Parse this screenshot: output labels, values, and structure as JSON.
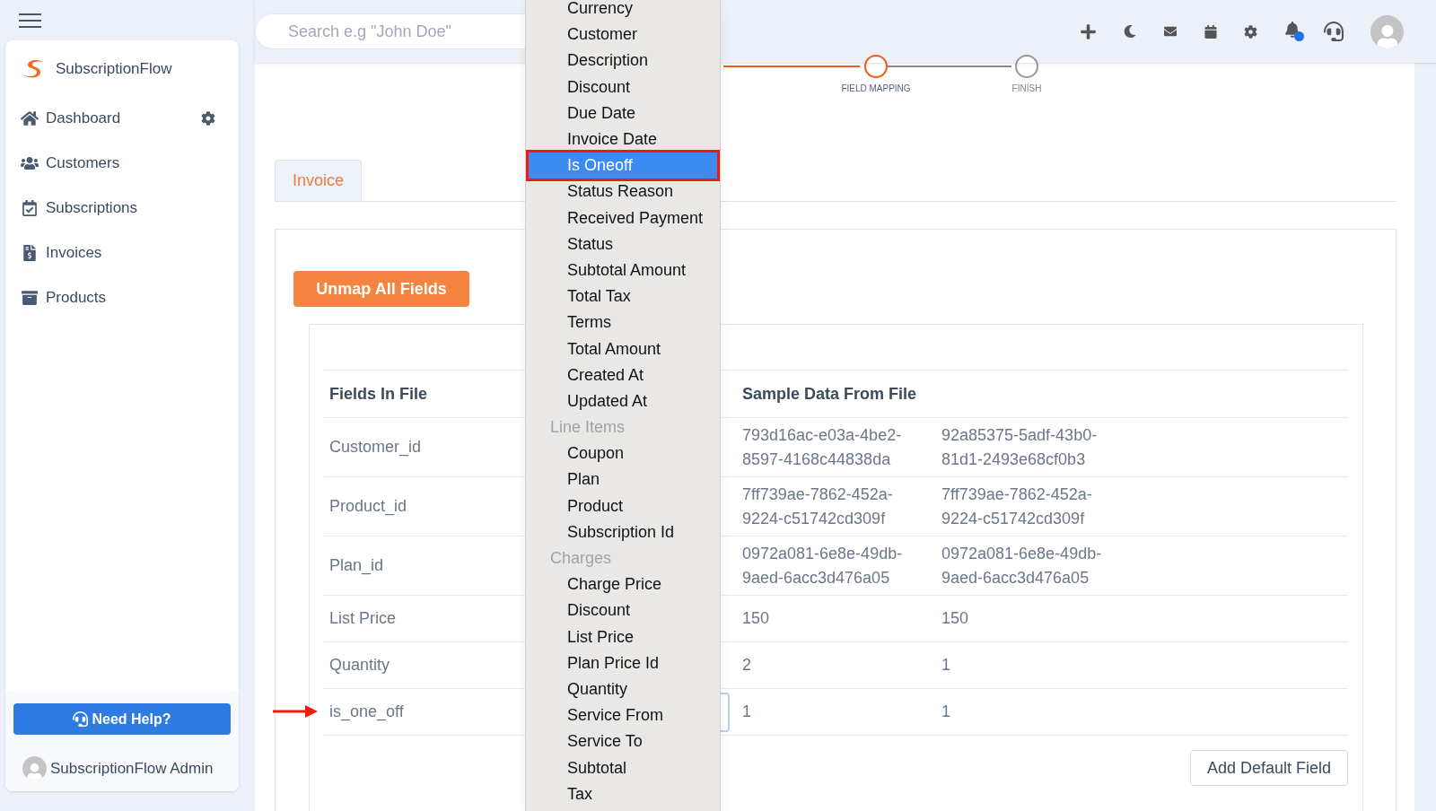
{
  "sidebar": {
    "brand": "SubscriptionFlow",
    "items": [
      {
        "label": "Dashboard",
        "settings": true
      },
      {
        "label": "Customers",
        "settings": false
      },
      {
        "label": "Subscriptions",
        "settings": false
      },
      {
        "label": "Invoices",
        "settings": false
      },
      {
        "label": "Products",
        "settings": false
      }
    ],
    "help_button": "Need Help?",
    "user": "SubscriptionFlow Admin"
  },
  "topbar": {
    "search": {
      "placeholder": "Search e.g \"John Doe\""
    },
    "notification_dot": true
  },
  "stepper": [
    {
      "label": "FIELD MAPPING",
      "current": true
    },
    {
      "label": "FINISH",
      "current": false
    }
  ],
  "tabs": [
    {
      "label": "Invoice",
      "selected": true
    }
  ],
  "unmap_button": "Unmap All Fields",
  "table": {
    "columns": [
      "Fields In File",
      "Sample Data From File"
    ],
    "rows": [
      {
        "field": "Customer_id",
        "sample_1": "793d16ac-e03a-4be2-8597-4168c44838da",
        "sample_2": "92a85375-5adf-43b0-81d1-2493e68cf0b3",
        "pointed": false
      },
      {
        "field": "Product_id",
        "sample_1": "7ff739ae-7862-452a-9224-c51742cd309f",
        "sample_2": "7ff739ae-7862-452a-9224-c51742cd309f",
        "pointed": false
      },
      {
        "field": "Plan_id",
        "sample_1": "0972a081-6e8e-49db-9aed-6acc3d476a05",
        "sample_2": "0972a081-6e8e-49db-9aed-6acc3d476a05",
        "pointed": false
      },
      {
        "field": "List Price",
        "sample_1": "150",
        "sample_2": "150",
        "pointed": false
      },
      {
        "field": "Quantity",
        "sample_1": "2",
        "sample_2": "1",
        "pointed": false
      },
      {
        "field": "is_one_off",
        "sample_1": "1",
        "sample_2": "1",
        "pointed": true
      }
    ]
  },
  "add_default_button": "Add Default Field",
  "dropdown": [
    {
      "kind": "option",
      "label": "Currency",
      "selected": false
    },
    {
      "kind": "option",
      "label": "Customer",
      "selected": false
    },
    {
      "kind": "option",
      "label": "Description",
      "selected": false
    },
    {
      "kind": "option",
      "label": "Discount",
      "selected": false
    },
    {
      "kind": "option",
      "label": "Due Date",
      "selected": false
    },
    {
      "kind": "option",
      "label": "Invoice Date",
      "selected": false
    },
    {
      "kind": "option",
      "label": "Is Oneoff",
      "selected": true
    },
    {
      "kind": "option",
      "label": "Status Reason",
      "selected": false
    },
    {
      "kind": "option",
      "label": "Received Payment",
      "selected": false
    },
    {
      "kind": "option",
      "label": "Status",
      "selected": false
    },
    {
      "kind": "option",
      "label": "Subtotal Amount",
      "selected": false
    },
    {
      "kind": "option",
      "label": "Total Tax",
      "selected": false
    },
    {
      "kind": "option",
      "label": "Terms",
      "selected": false
    },
    {
      "kind": "option",
      "label": "Total Amount",
      "selected": false
    },
    {
      "kind": "option",
      "label": "Created At",
      "selected": false
    },
    {
      "kind": "option",
      "label": "Updated At",
      "selected": false
    },
    {
      "kind": "group",
      "label": "Line Items"
    },
    {
      "kind": "option",
      "label": "Coupon",
      "selected": false
    },
    {
      "kind": "option",
      "label": "Plan",
      "selected": false
    },
    {
      "kind": "option",
      "label": "Product",
      "selected": false
    },
    {
      "kind": "option",
      "label": "Subscription Id",
      "selected": false
    },
    {
      "kind": "group",
      "label": "Charges"
    },
    {
      "kind": "option",
      "label": "Charge Price",
      "selected": false
    },
    {
      "kind": "option",
      "label": "Discount",
      "selected": false
    },
    {
      "kind": "option",
      "label": "List Price",
      "selected": false
    },
    {
      "kind": "option",
      "label": "Plan Price Id",
      "selected": false
    },
    {
      "kind": "option",
      "label": "Quantity",
      "selected": false
    },
    {
      "kind": "option",
      "label": "Service From",
      "selected": false
    },
    {
      "kind": "option",
      "label": "Service To",
      "selected": false
    },
    {
      "kind": "option",
      "label": "Subtotal",
      "selected": false
    },
    {
      "kind": "option",
      "label": "Tax",
      "selected": false
    }
  ]
}
